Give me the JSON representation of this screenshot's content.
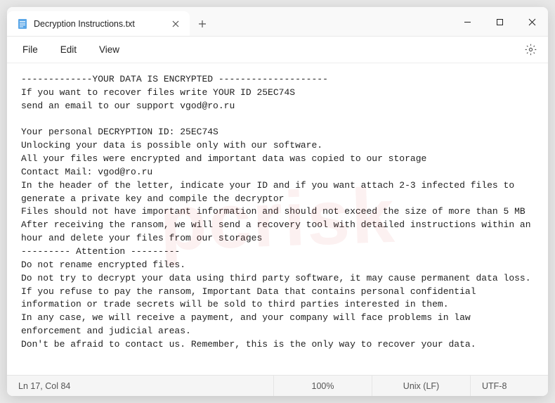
{
  "tab": {
    "title": "Decryption Instructions.txt"
  },
  "menu": {
    "file": "File",
    "edit": "Edit",
    "view": "View"
  },
  "content": {
    "text": "-------------YOUR DATA IS ENCRYPTED --------------------\nIf you want to recover files write YOUR ID 25EC74S\nsend an email to our support vgod@ro.ru\n\nYour personal DECRYPTION ID: 25EC74S\nUnlocking your data is possible only with our software.\nAll your files were encrypted and important data was copied to our storage\nContact Mail: vgod@ro.ru\nIn the header of the letter, indicate your ID and if you want attach 2-3 infected files to generate a private key and compile the decryptor\nFiles should not have important information and should not exceed the size of more than 5 MB\nAfter receiving the ransom, we will send a recovery tool with detailed instructions within an hour and delete your files from our storages\n--------- Attention ---------\nDo not rename encrypted files.\nDo not try to decrypt your data using third party software, it may cause permanent data loss.\nIf you refuse to pay the ransom, Important Data that contains personal confidential information or trade secrets will be sold to third parties interested in them.\nIn any case, we will receive a payment, and your company will face problems in law enforcement and judicial areas.\nDon't be afraid to contact us. Remember, this is the only way to recover your data."
  },
  "status": {
    "position": "Ln 17, Col 84",
    "zoom": "100%",
    "line_ending": "Unix (LF)",
    "encoding": "UTF-8"
  }
}
